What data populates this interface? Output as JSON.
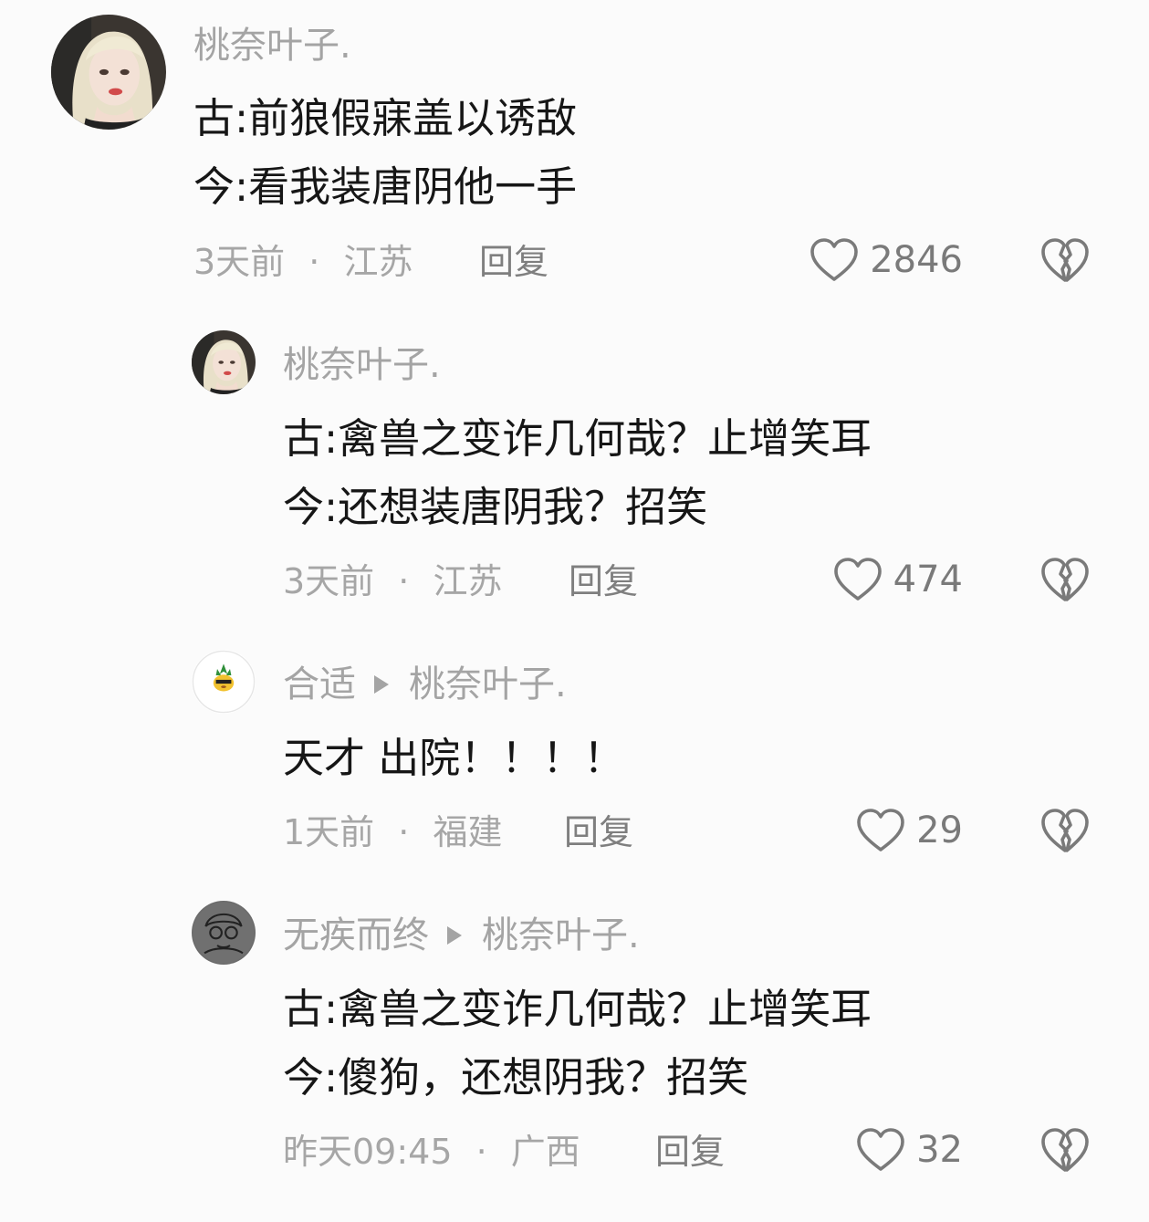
{
  "comments": [
    {
      "username": "桃奈叶子.",
      "reply_to": "",
      "lines": [
        "古:前狼假寐盖以诱敌",
        "今:看我装唐阴他一手"
      ],
      "time": "3天前",
      "location": "江苏",
      "reply_label": "回复",
      "likes": "2846",
      "avatar": "photo-avatar-blonde"
    },
    {
      "username": "桃奈叶子.",
      "reply_to": "",
      "lines": [
        "古:禽兽之变诈几何哉？止增笑耳",
        "今:还想装唐阴我？招笑"
      ],
      "time": "3天前",
      "location": "江苏",
      "reply_label": "回复",
      "likes": "474",
      "avatar": "photo-avatar-blonde"
    },
    {
      "username": "合适",
      "reply_to": "桃奈叶子.",
      "lines": [
        "天才 出院！！！！"
      ],
      "time": "1天前",
      "location": "福建",
      "reply_label": "回复",
      "likes": "29",
      "avatar": "pineapple-avatar"
    },
    {
      "username": "无疾而终",
      "reply_to": "桃奈叶子.",
      "lines": [
        "古:禽兽之变诈几何哉？止增笑耳",
        "今:傻狗，还想阴我？招笑"
      ],
      "time": "昨天09:45",
      "location": "广西",
      "reply_label": "回复",
      "likes": "32",
      "avatar": "sketch-avatar"
    }
  ],
  "separator": "·",
  "icons": {
    "like": "heart-outline-icon",
    "dislike": "broken-heart-icon"
  },
  "colors": {
    "background": "#fbfbfb",
    "text": "#161616",
    "muted": "#a4a4a4",
    "icon": "#7a7a7a"
  }
}
